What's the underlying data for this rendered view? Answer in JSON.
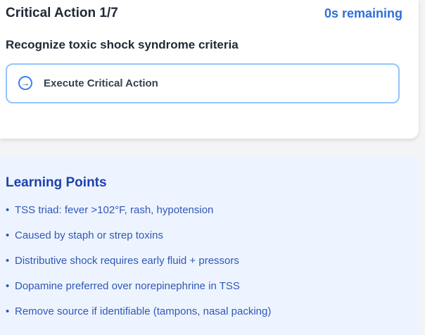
{
  "card": {
    "title": "Critical Action 1/7",
    "timer": "0s remaining",
    "subtitle": "Recognize toxic shock syndrome criteria",
    "action": {
      "icon": "arrow-right-icon",
      "label": "Execute Critical Action"
    }
  },
  "learning": {
    "title": "Learning Points",
    "bullet": "•",
    "items": [
      "TSS triad: fever >102°F, rash, hypotension",
      "Caused by staph or strep toxins",
      "Distributive shock requires early fluid + pressors",
      "Dopamine preferred over norepinephrine in TSS",
      "Remove source if identifiable (tampons, nasal packing)"
    ]
  },
  "colors": {
    "accent": "#2f6fd6",
    "button_border": "#93c5fd",
    "learning_bg": "#eef4ff",
    "learning_title": "#1e40af",
    "learning_text": "#2f58b8"
  }
}
